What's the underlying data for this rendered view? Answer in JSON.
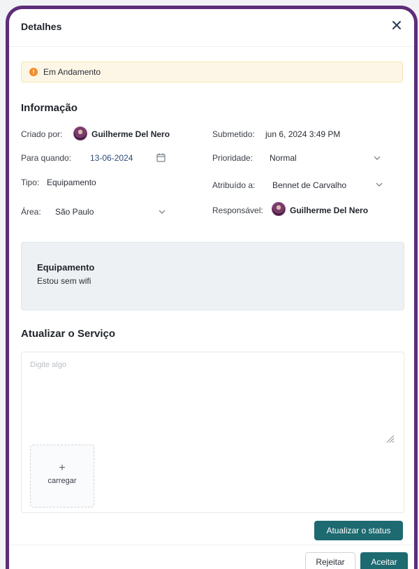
{
  "dialog": {
    "title": "Detalhes"
  },
  "status": {
    "label": "Em Andamento",
    "icon": "exclamation-icon",
    "color": "#f08c2b"
  },
  "info": {
    "section_title": "Informação",
    "created_by_label": "Criado por:",
    "created_by_value": "Guilherme Del Nero",
    "submitted_label": "Submetido:",
    "submitted_value": "jun 6, 2024 3:49 PM",
    "due_label": "Para quando:",
    "due_value": "13-06-2024",
    "priority_label": "Prioridade:",
    "priority_value": "Normal",
    "type_label": "Tipo:",
    "type_value": "Equipamento",
    "assigned_label": "Atribuído a:",
    "assigned_value": "Bennet de Carvalho",
    "area_label": "Área:",
    "area_value": "São Paulo",
    "responsible_label": "Responsável:",
    "responsible_value": "Guilherme Del Nero"
  },
  "card": {
    "title": "Equipamento",
    "text": "Estou sem wifi"
  },
  "update": {
    "section_title": "Atualizar o Serviço",
    "placeholder": "Digite algo",
    "upload_plus": "+",
    "upload_label": "carregar",
    "update_button": "Atualizar o status"
  },
  "footer": {
    "reject_button": "Rejeitar",
    "accept_button": "Aceitar"
  },
  "colors": {
    "accent": "#1d6a70",
    "frame": "#5e2d79",
    "status_bg": "#fdf6e6"
  }
}
